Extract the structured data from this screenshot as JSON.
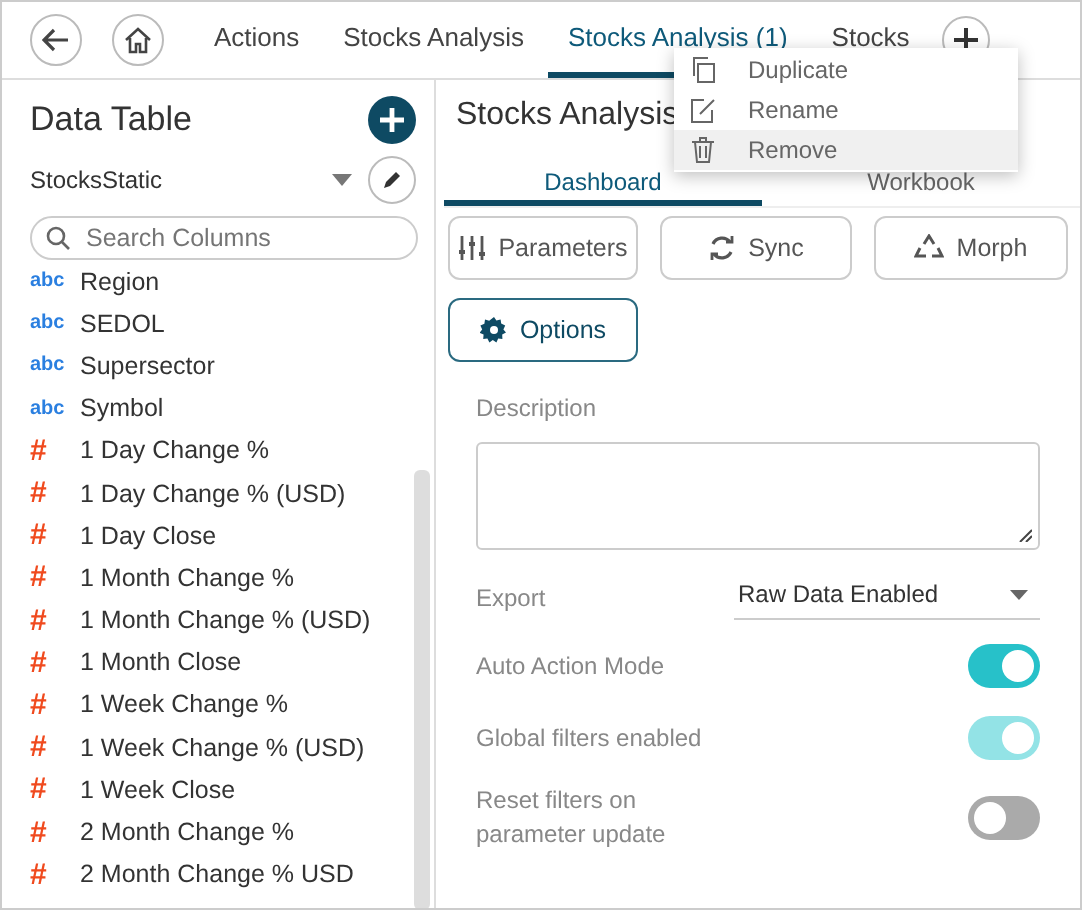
{
  "top_tabs": [
    {
      "label": "Actions",
      "selected": false
    },
    {
      "label": "Stocks Analysis",
      "selected": false
    },
    {
      "label": "Stocks Analysis (1)",
      "selected": true
    },
    {
      "label": "Stocks",
      "selected": false
    }
  ],
  "context_menu": [
    {
      "label": "Duplicate",
      "selected": false
    },
    {
      "label": "Rename",
      "selected": false
    },
    {
      "label": "Remove",
      "selected": true
    }
  ],
  "data_table": {
    "title": "Data Table",
    "source": "StocksStatic",
    "search": {
      "placeholder": "Search Columns"
    },
    "columns": [
      {
        "name": "Region",
        "kind": "text",
        "type_label": "abc"
      },
      {
        "name": "SEDOL",
        "kind": "text",
        "type_label": "abc"
      },
      {
        "name": "Supersector",
        "kind": "text",
        "type_label": "abc"
      },
      {
        "name": "Symbol",
        "kind": "text",
        "type_label": "abc"
      },
      {
        "name": "1 Day Change %",
        "kind": "number",
        "type_label": "#"
      },
      {
        "name": "1 Day Change % (USD)",
        "kind": "number",
        "type_label": "#"
      },
      {
        "name": "1 Day Close",
        "kind": "number",
        "type_label": "#"
      },
      {
        "name": "1 Month Change %",
        "kind": "number",
        "type_label": "#"
      },
      {
        "name": "1 Month Change % (USD)",
        "kind": "number",
        "type_label": "#"
      },
      {
        "name": "1 Month Close",
        "kind": "number",
        "type_label": "#"
      },
      {
        "name": "1 Week Change %",
        "kind": "number",
        "type_label": "#"
      },
      {
        "name": "1 Week Change % (USD)",
        "kind": "number",
        "type_label": "#"
      },
      {
        "name": "1 Week Close",
        "kind": "number",
        "type_label": "#"
      },
      {
        "name": "2 Month Change %",
        "kind": "number",
        "type_label": "#"
      },
      {
        "name": "2 Month Change % USD",
        "kind": "number",
        "type_label": "#"
      }
    ]
  },
  "panel": {
    "title": "Stocks Analysis",
    "tabs": [
      {
        "label": "Dashboard",
        "selected": true
      },
      {
        "label": "Workbook",
        "selected": false
      }
    ],
    "buttons": [
      {
        "label": "Parameters",
        "selected": false
      },
      {
        "label": "Sync",
        "selected": false
      },
      {
        "label": "Morph",
        "selected": false
      },
      {
        "label": "Options",
        "selected": true
      }
    ],
    "description_label": "Description",
    "export": {
      "label": "Export",
      "value": "Raw Data Enabled"
    },
    "settings": [
      {
        "label": "Auto Action Mode",
        "on": true,
        "disabled": false
      },
      {
        "label": "Global filters enabled",
        "on": true,
        "disabled": true
      },
      {
        "label": "Reset filters on parameter update",
        "on": false,
        "disabled": false
      }
    ]
  }
}
